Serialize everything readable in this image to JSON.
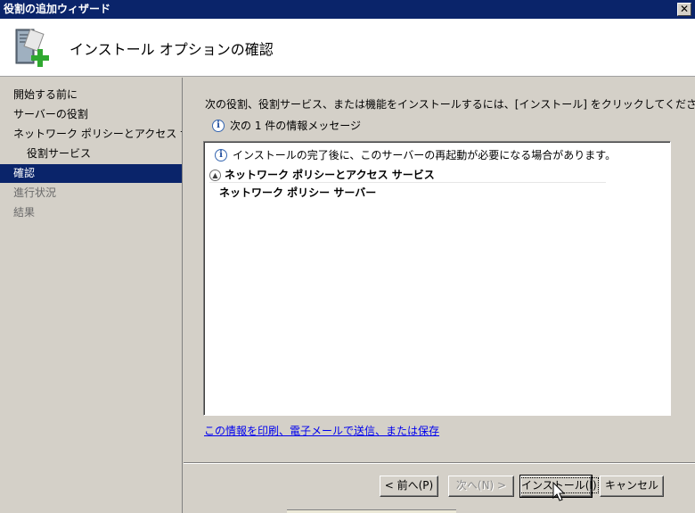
{
  "window": {
    "title": "役割の追加ウィザード",
    "close_label": "✕"
  },
  "header": {
    "title": "インストール オプションの確認",
    "icon": "server-add-role-icon"
  },
  "sidebar": {
    "items": [
      {
        "label": "開始する前に",
        "state": "normal"
      },
      {
        "label": "サーバーの役割",
        "state": "normal"
      },
      {
        "label": "ネットワーク ポリシーとアクセス サービ...",
        "state": "normal"
      },
      {
        "label": "役割サービス",
        "state": "normal"
      },
      {
        "label": "確認",
        "state": "active"
      },
      {
        "label": "進行状況",
        "state": "disabled"
      },
      {
        "label": "結果",
        "state": "disabled"
      }
    ]
  },
  "main": {
    "instruction": "次の役割、役割サービス、または機能をインストールするには、[インストール] をクリックしてください。",
    "message_count": "次の 1 件の情報メッセージ",
    "panel": {
      "warning": "インストールの完了後に、このサーバーの再起動が必要になる場合があります。",
      "section_title": "ネットワーク ポリシーとアクセス サービス",
      "section_item": "ネットワーク ポリシー サーバー"
    },
    "link": "この情報を印刷、電子メールで送信、または保存"
  },
  "buttons": {
    "prev": "< 前へ(P)",
    "next": "次へ(N) >",
    "install": "インストール(I)",
    "cancel": "キャンセル"
  },
  "colors": {
    "titlebar": "#0a246a",
    "selection": "#0a246a",
    "link": "#0000ee"
  }
}
